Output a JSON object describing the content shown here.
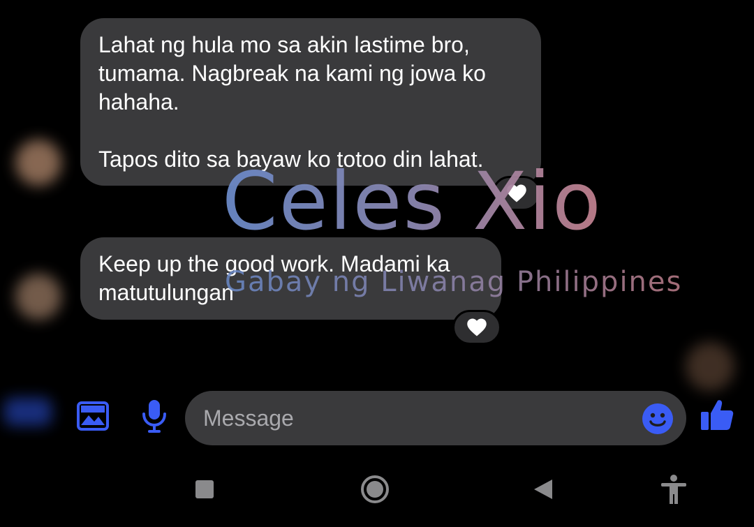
{
  "messages": [
    {
      "text": "Lahat ng hula mo sa akin lastime bro,\ntumama. Nagbreak na kami ng jowa ko\nhahaha.\n\nTapos dito sa bayaw ko totoo din lahat.",
      "reaction": "white-heart"
    },
    {
      "text": "Keep up the good work. Madami ka\nmatutulungan",
      "reaction": "white-heart"
    }
  ],
  "watermark": {
    "title": "Celes Xio",
    "subtitle": "Gabay ng Liwanag Philippines"
  },
  "composer": {
    "placeholder": "Message",
    "icons": [
      "gallery-icon",
      "microphone-icon",
      "emoji-icon",
      "thumbs-up-icon"
    ]
  },
  "colors": {
    "accent": "#3a5cf5",
    "bubble": "#3a3a3c",
    "background": "#000000"
  },
  "navbar": {
    "icons": [
      "recent-apps-icon",
      "home-icon",
      "back-icon",
      "accessibility-icon"
    ]
  }
}
